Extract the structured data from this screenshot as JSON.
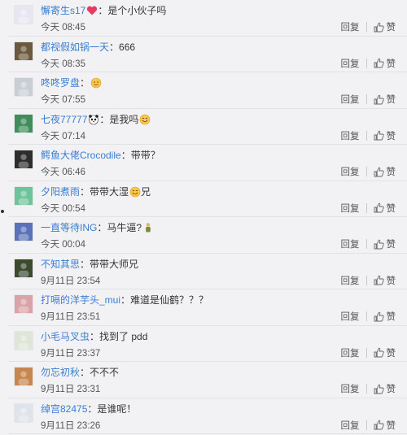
{
  "comments": [
    {
      "user": "懈寄生s17",
      "sep": "：",
      "text": "是个小伙子吗",
      "emoji": "heart-icon",
      "emoji_pos": "before",
      "time": "今天 08:45",
      "reply": "回复",
      "like": "赞",
      "avatar_color": "#e9e5f1"
    },
    {
      "user": "都视假如锅一天",
      "sep": "：",
      "text": "666",
      "emoji": "",
      "emoji_pos": "",
      "time": "今天 08:35",
      "reply": "回复",
      "like": "赞",
      "avatar_color": "#6b5a3d"
    },
    {
      "user": "咚咚罗盘",
      "sep": "：",
      "text": "",
      "emoji": "sun-face-icon",
      "emoji_pos": "after",
      "time": "今天 07:55",
      "reply": "回复",
      "like": "赞",
      "avatar_color": "#c9ced6"
    },
    {
      "user": "七夜77777",
      "sep": "：",
      "text": "是我吗",
      "emoji": "panda-icon",
      "emoji_pos": "before-sep",
      "emoji2": "smile-icon",
      "time": "今天 07:14",
      "reply": "回复",
      "like": "赞",
      "avatar_color": "#3f8d5a"
    },
    {
      "user": "鳄鱼大佬Crocodile",
      "sep": "：",
      "text": "带带？",
      "emoji": "",
      "emoji_pos": "",
      "time": "今天 06:46",
      "reply": "回复",
      "like": "赞",
      "avatar_color": "#2d2d2d"
    },
    {
      "user": "夕阳煮雨",
      "sep": "：",
      "text": "带带大湿",
      "text2": "兄",
      "emoji": "smile-icon",
      "emoji_pos": "mid",
      "time": "今天 00:54",
      "reply": "回复",
      "like": "赞",
      "avatar_color": "#6fc39a"
    },
    {
      "user": "一直等待ING",
      "sep": "：",
      "text": "马牛逼?",
      "emoji": "figure-icon",
      "emoji_pos": "after",
      "time": "今天 00:04",
      "reply": "回复",
      "like": "赞",
      "avatar_color": "#5a73b8"
    },
    {
      "user": "不知其思",
      "sep": "：",
      "text": "带带大师兄",
      "emoji": "",
      "emoji_pos": "",
      "time": "9月11日 23:54",
      "reply": "回复",
      "like": "赞",
      "avatar_color": "#3c4a2e"
    },
    {
      "user": "打嗝的洋芋头_mui",
      "sep": "：",
      "text": "难道是仙鹤？？？",
      "emoji": "",
      "emoji_pos": "",
      "time": "9月11日 23:51",
      "reply": "回复",
      "like": "赞",
      "avatar_color": "#d9a3a8"
    },
    {
      "user": "小毛马叉虫",
      "sep": "：",
      "text": "找到了  pdd",
      "emoji": "",
      "emoji_pos": "",
      "time": "9月11日 23:37",
      "reply": "回复",
      "like": "赞",
      "avatar_color": "#dfe5d8"
    },
    {
      "user": "勿忘初秋",
      "sep": "：",
      "text": "不不不",
      "emoji": "",
      "emoji_pos": "",
      "time": "9月11日 23:31",
      "reply": "回复",
      "like": "赞",
      "avatar_color": "#c6864e"
    },
    {
      "user": "绰宫82475",
      "sep": "：",
      "text": "是谁呢！",
      "emoji": "",
      "emoji_pos": "",
      "time": "9月11日 23:26",
      "reply": "回复",
      "like": "赞",
      "avatar_color": "#dfe4ea"
    }
  ]
}
